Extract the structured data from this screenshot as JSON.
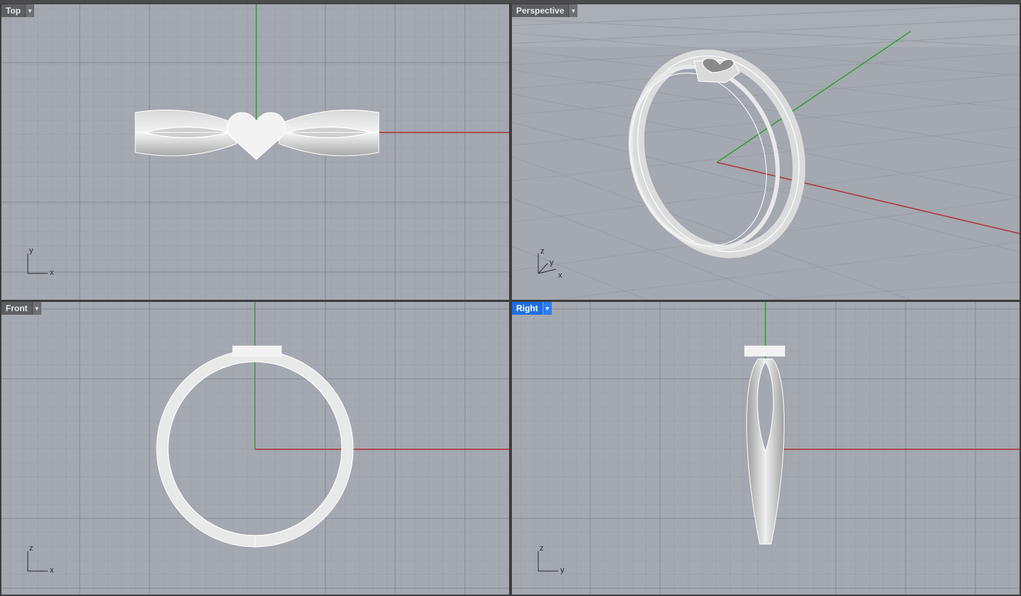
{
  "viewports": {
    "top": {
      "label": "Top"
    },
    "perspective": {
      "label": "Perspective"
    },
    "front": {
      "label": "Front"
    },
    "right": {
      "label": "Right",
      "active": true
    }
  },
  "axes": {
    "top": {
      "h": "x",
      "v": "y"
    },
    "perspective": {
      "a": "x",
      "b": "y",
      "c": "z"
    },
    "front": {
      "h": "x",
      "v": "z"
    },
    "right": {
      "h": "y",
      "v": "z"
    }
  },
  "icons": {
    "tab_dropdown": "chevron-down-icon"
  },
  "colors": {
    "viewport_bg": "#a4a8b0",
    "grid_minor": "#979ba3",
    "grid_major": "#858991",
    "x_axis": "#b03030",
    "y_axis": "#30a030",
    "active_tab": "#1f6fe0",
    "object": "#f2f2f2"
  }
}
